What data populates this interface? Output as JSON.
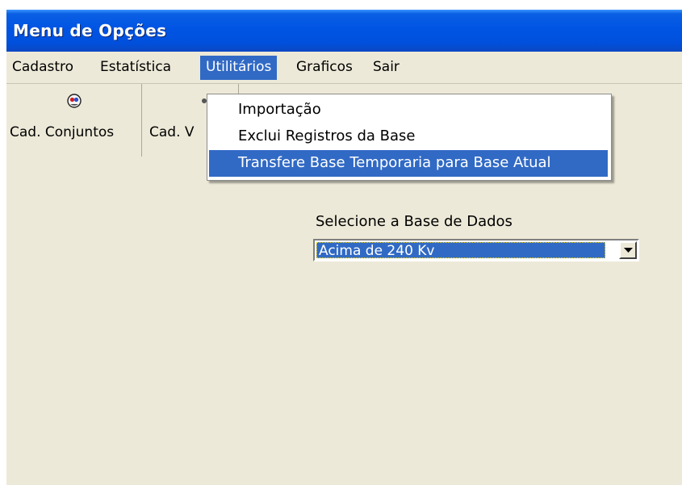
{
  "window": {
    "title": "Menu de Opções"
  },
  "menubar": {
    "items": [
      {
        "label": "Cadastro"
      },
      {
        "label": "Estatística"
      },
      {
        "label": "Utilitários",
        "active": true
      },
      {
        "label": "Graficos"
      },
      {
        "label": "Sair"
      }
    ]
  },
  "toolbar": {
    "buttons": [
      {
        "label": "Cad. Conjuntos",
        "icon": "people-icon"
      },
      {
        "label": "Cad. V",
        "icon": "toolbar-icon"
      }
    ]
  },
  "utilitarios_menu": {
    "items": [
      {
        "label": "Importação"
      },
      {
        "label": "Exclui Registros da Base"
      },
      {
        "label": "Transfere Base Temporaria para Base Atual",
        "selected": true
      }
    ]
  },
  "database_selector": {
    "label": "Selecione a Base de Dados",
    "selected_value": "Acima de 240 Kv"
  },
  "colors": {
    "titlebar": "#0054e3",
    "highlight": "#316ac5",
    "window_bg": "#ece9d8"
  }
}
